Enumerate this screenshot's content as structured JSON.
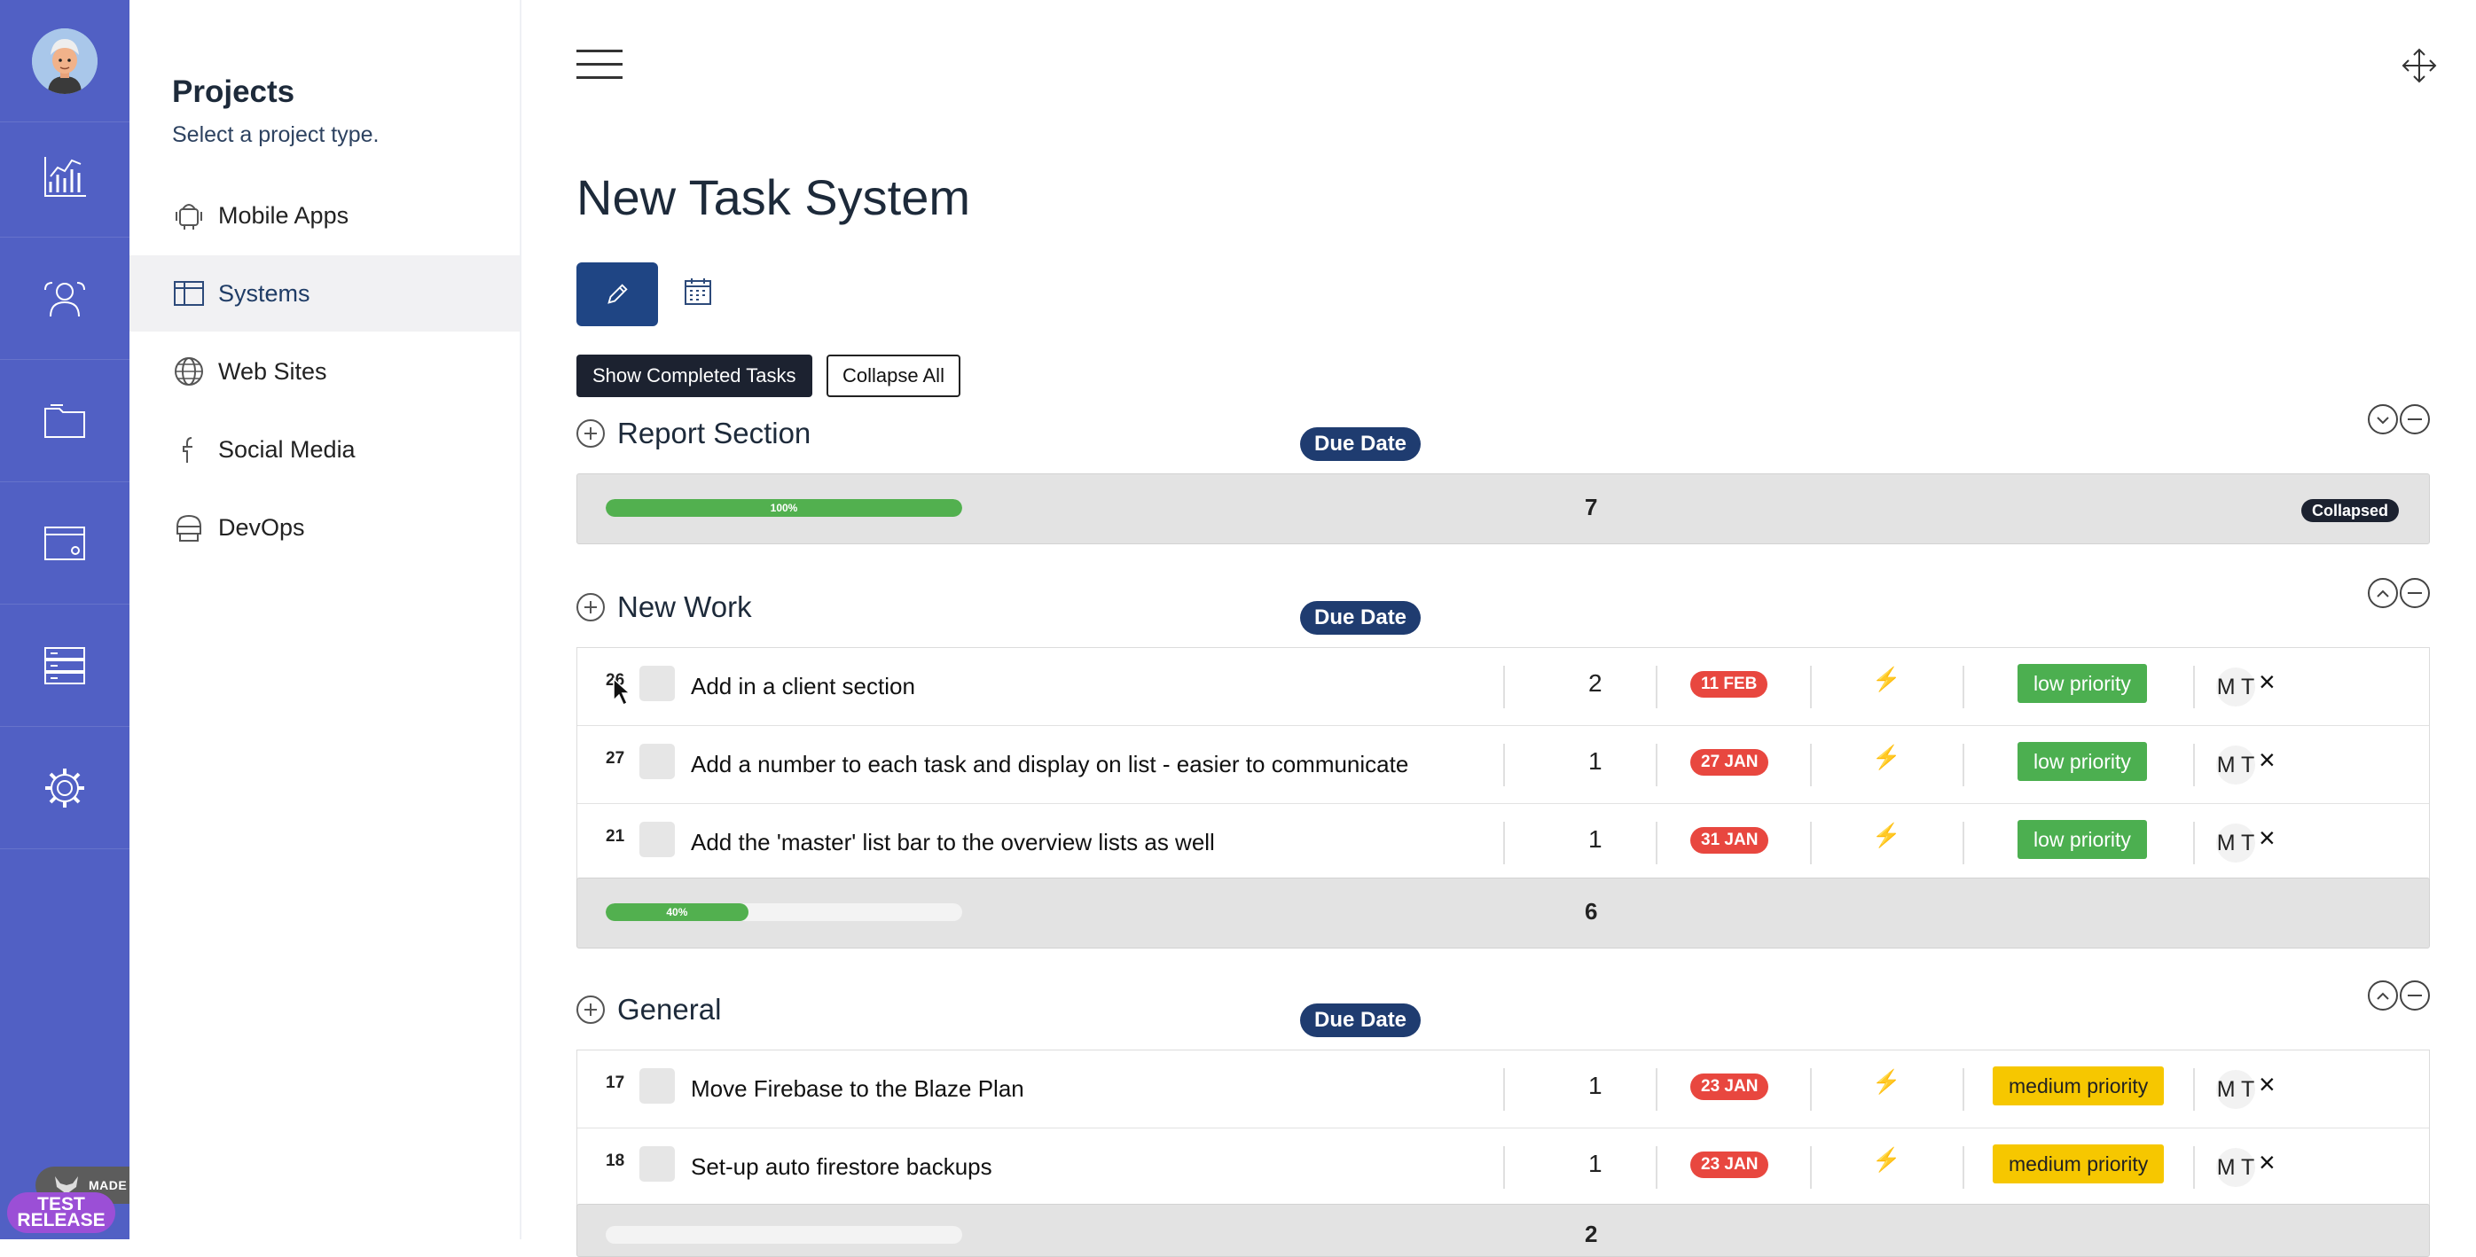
{
  "app": {
    "page_title": "New Task System"
  },
  "sidebar": {
    "icons": [
      "avatar",
      "chart-icon",
      "team-icon",
      "folder-icon",
      "browser-icon",
      "server-icon",
      "gear-icon"
    ]
  },
  "projects": {
    "title": "Projects",
    "subtitle": "Select a project type.",
    "items": [
      {
        "label": "Mobile Apps",
        "icon": "android-icon"
      },
      {
        "label": "Systems",
        "icon": "table-icon",
        "active": true
      },
      {
        "label": "Web Sites",
        "icon": "globe-icon"
      },
      {
        "label": "Social Media",
        "icon": "facebook-icon"
      },
      {
        "label": "DevOps",
        "icon": "devops-icon"
      }
    ]
  },
  "toolbar": {
    "show_completed_label": "Show Completed Tasks",
    "collapse_all_label": "Collapse All"
  },
  "sections": [
    {
      "name": "Report Section",
      "due_label": "Due Date",
      "summary": {
        "progress_label": "100%",
        "progress": 1.0,
        "count": "7",
        "badge": "Collapsed"
      },
      "tasks": []
    },
    {
      "name": "New Work",
      "due_label": "Due Date",
      "summary": {
        "progress_label": "40%",
        "progress": 0.4,
        "count": "6"
      },
      "tasks": [
        {
          "num": "26",
          "name": "Add in a client section",
          "count": "2",
          "date": "11 FEB",
          "priority": "low priority",
          "assignee": "M T"
        },
        {
          "num": "27",
          "name": "Add a number to each task and display on list - easier to communicate",
          "count": "1",
          "date": "27 JAN",
          "priority": "low priority",
          "assignee": "M T"
        },
        {
          "num": "21",
          "name": "Add the 'master' list bar to the overview lists as well",
          "count": "1",
          "date": "31 JAN",
          "priority": "low priority",
          "assignee": "M T"
        }
      ]
    },
    {
      "name": "General",
      "due_label": "Due Date",
      "summary": {
        "count": "2"
      },
      "tasks": [
        {
          "num": "17",
          "name": "Move Firebase to the Blaze Plan",
          "count": "1",
          "date": "23 JAN",
          "priority": "medium priority",
          "assignee": "M T"
        },
        {
          "num": "18",
          "name": "Set-up auto firestore backups",
          "count": "1",
          "date": "23 JAN",
          "priority": "medium priority",
          "assignee": "M T"
        }
      ]
    }
  ],
  "symbols": {
    "bolt": "⚡",
    "remove": "×"
  },
  "overlay": {
    "gifox": "MADE WITH GIFOX",
    "release_line1": "TEST",
    "release_line2": "RELEASE"
  },
  "colors": {
    "rail": "#5160c4",
    "primary": "#1f4584",
    "low": "#4caf50",
    "medium": "#f6c700",
    "date": "#e8473f"
  }
}
